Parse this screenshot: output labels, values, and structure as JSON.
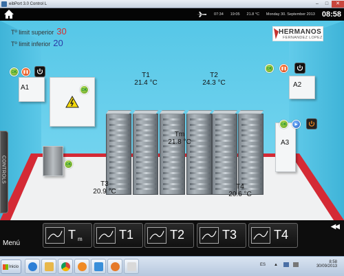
{
  "window": {
    "title": "eibPort 3.0 Control L"
  },
  "status": {
    "time1": "07:34",
    "time2": "19:05",
    "temperature": "21.8 °C",
    "date": "Monday 30. September 2013",
    "clock": "08:58"
  },
  "limits": {
    "superior_label": "Tº limit superior",
    "superior_value": "30",
    "inferior_label": "Tº limit inferior",
    "inferior_value": "20"
  },
  "logo": {
    "line1": "HERMANOS",
    "line2": "FERNANDEZ LOPEZ"
  },
  "units": {
    "a1": "A1",
    "a2": "A2",
    "a3": "A3"
  },
  "buttons": {
    "ok": "OK"
  },
  "sensors": {
    "t1": {
      "name": "T1",
      "value": "21.4 °C"
    },
    "t2": {
      "name": "T2",
      "value": "24.3 °C"
    },
    "tm": {
      "name": "Tm",
      "value": "21.8 °C"
    },
    "t3": {
      "name": "T3",
      "value": "20.9 °C"
    },
    "t4": {
      "name": "T4",
      "value": "20.6 °C"
    }
  },
  "side_tab": "CONTROLS",
  "bottom": {
    "menu": "Menú",
    "tabs": [
      "T",
      "T1",
      "T2",
      "T3",
      "T4"
    ],
    "tm_sub": "m",
    "arrows": "◀◀"
  },
  "taskbar": {
    "start": "Inicio",
    "lang": "ES",
    "time": "8:58",
    "date": "30/09/2013"
  }
}
